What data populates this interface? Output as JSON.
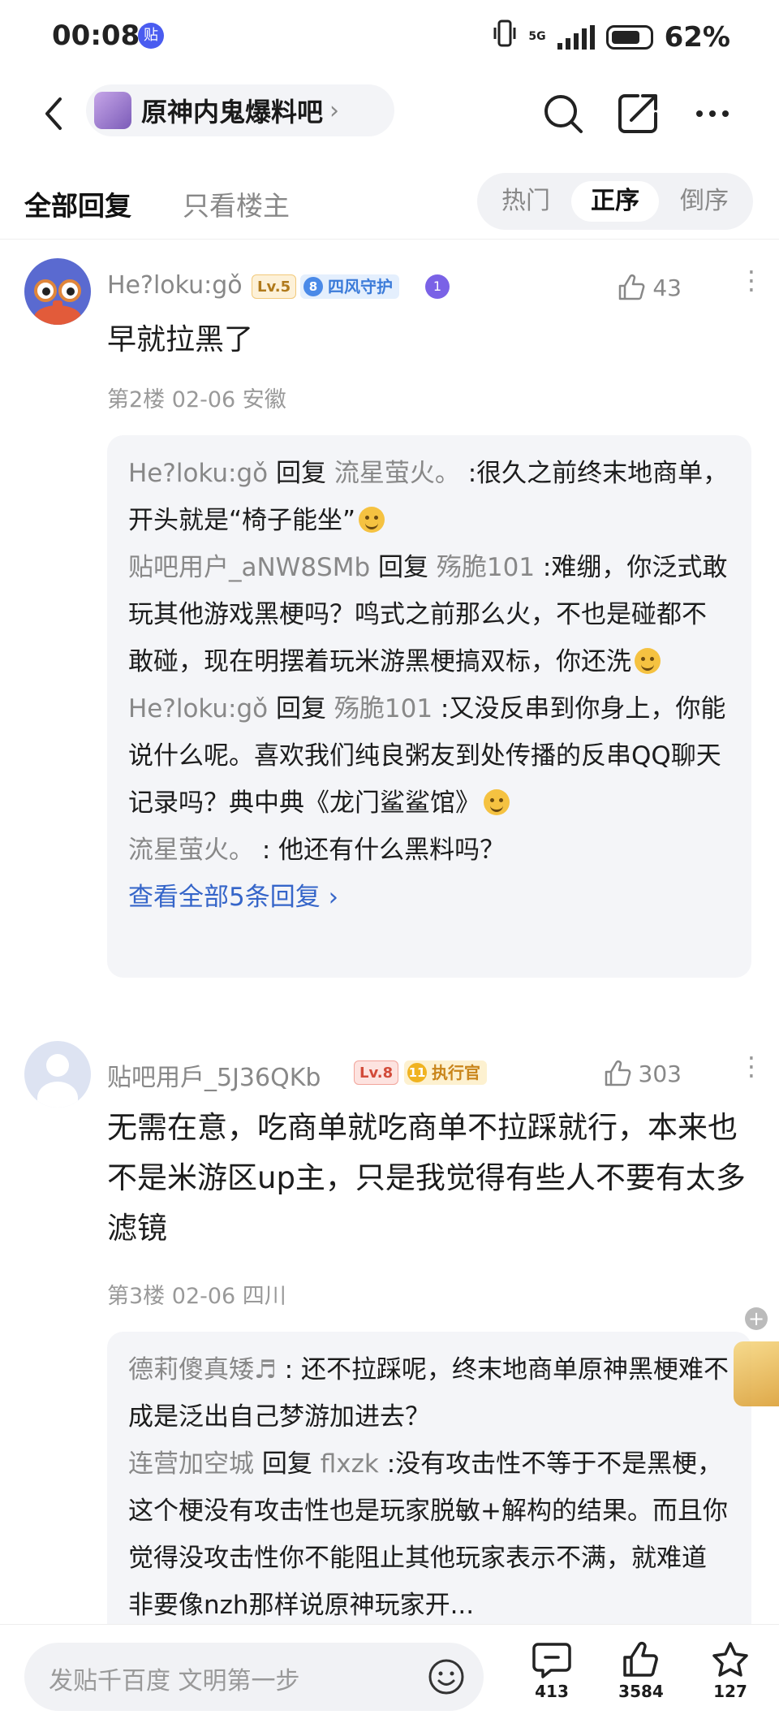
{
  "status_bar": {
    "time": "00:08",
    "app_badge": "贴",
    "network": "5G",
    "battery": "62%"
  },
  "nav": {
    "forum_name": "原神内鬼爆料吧"
  },
  "tabs": {
    "all_replies": "全部回复",
    "host_only": "只看楼主",
    "sort": [
      "热门",
      "正序",
      "倒序"
    ],
    "sort_selected": "正序"
  },
  "posts": [
    {
      "username": "He?loku:gǒ",
      "level": "Lv.5",
      "fan_badge_num": "8",
      "fan_badge": "四风守护",
      "honor_icon": "1",
      "likes": "43",
      "content": "早就拉黑了",
      "meta": "第2楼 02-06 安徽",
      "replies": [
        {
          "from": "He?loku:gǒ",
          "word": "回复",
          "to": "流星萤火。",
          "text": ":很久之前终末地商单，开头就是“椅子能坐”",
          "emoji": "sweat-face"
        },
        {
          "from": "贴吧用户_aNW8SMb",
          "word": "回复",
          "to": "殇脆101",
          "text": ":难绷，你泛式敢玩其他游戏黑梗吗？鸣式之前那么火，不也是碰都不敢碰，现在明摆着玩米游黑梗搞双标，你还洗",
          "emoji": "laugh-face"
        },
        {
          "from": "He?loku:gǒ",
          "word": "回复",
          "to": "殇脆101",
          "text": ":又没反串到你身上，你能说什么呢。喜欢我们纯良粥友到处传播的反串QQ聊天记录吗？典中典《龙门鲨鲨馆》",
          "emoji": "grin-sweat-face"
        },
        {
          "from": "流星萤火。",
          "word": "",
          "to": "",
          "text": ": 他还有什么黑料吗？",
          "emoji": ""
        }
      ],
      "view_all": "查看全部5条回复 ›"
    },
    {
      "username": "贴吧用戶_5J36QKb",
      "level": "Lv.8",
      "fan_badge_num": "11",
      "fan_badge": "执行官",
      "likes": "303",
      "content": "无需在意，吃商单就吃商单不拉踩就行，本来也不是米游区up主，只是我觉得有些人不要有太多滤镜",
      "meta": "第3楼 02-06 四川",
      "replies": [
        {
          "from": "德莉傻真矮♬",
          "word": "",
          "to": "",
          "text": ": 还不拉踩呢，终末地商单原神黑梗难不成是泛出自己梦游加进去？"
        },
        {
          "from": "连营加空城",
          "word": "回复",
          "to": "flxzk",
          "text": ":没有攻击性不等于不是黑梗，这个梗没有攻击性也是玩家脱敏+解构的结果。而且你觉得没攻击性你不能阻止其他玩家表示不满，就难道非要像nzh那样说原神玩家开..."
        }
      ]
    }
  ],
  "bottom_bar": {
    "compose_placeholder": "发贴千百度 文明第一步",
    "comments": "413",
    "likes": "3584",
    "favorites": "127"
  }
}
